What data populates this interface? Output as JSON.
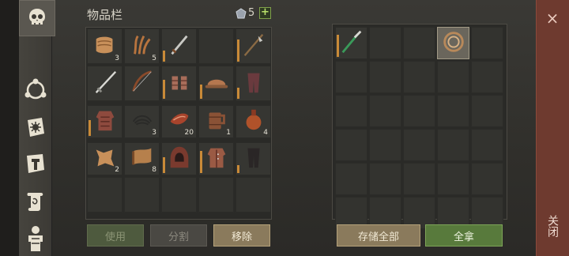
{
  "header": {
    "title": "物品栏",
    "gem_count": "5",
    "add_label": "+"
  },
  "inventory": {
    "rows": [
      [
        {
          "icon": "cloth-icon",
          "qty": "3"
        },
        {
          "icon": "fiber-icon",
          "qty": "5"
        },
        {
          "icon": "sword-icon",
          "qty": ""
        },
        {
          "icon": "",
          "qty": ""
        },
        {
          "icon": "halberd-icon",
          "qty": ""
        }
      ],
      [
        {
          "icon": "long-sword-icon",
          "qty": ""
        },
        {
          "icon": "bow-icon",
          "qty": ""
        },
        {
          "icon": "gloves-icon",
          "qty": ""
        },
        {
          "icon": "helmet-icon",
          "qty": ""
        },
        {
          "icon": "pants-icon",
          "qty": ""
        }
      ],
      [
        {
          "icon": "leather-armor-icon",
          "qty": ""
        },
        {
          "icon": "rope-icon",
          "qty": "3"
        },
        {
          "icon": "meat-icon",
          "qty": "20"
        },
        {
          "icon": "mug-icon",
          "qty": "1"
        },
        {
          "icon": "flask-icon",
          "qty": "4"
        }
      ],
      [
        {
          "icon": "hide-icon",
          "qty": "2"
        },
        {
          "icon": "scroll-leather-icon",
          "qty": "8"
        },
        {
          "icon": "hood-icon",
          "qty": ""
        },
        {
          "icon": "vest-icon",
          "qty": ""
        },
        {
          "icon": "dark-pants-icon",
          "qty": ""
        }
      ],
      [
        {
          "icon": "",
          "qty": ""
        },
        {
          "icon": "",
          "qty": ""
        },
        {
          "icon": "",
          "qty": ""
        },
        {
          "icon": "",
          "qty": ""
        },
        {
          "icon": "",
          "qty": ""
        }
      ]
    ]
  },
  "container": {
    "items": [
      {
        "icon": "dagger-icon"
      },
      {
        "icon": "coiled-rope-icon"
      }
    ]
  },
  "buttons": {
    "use": "使用",
    "split": "分割",
    "remove": "移除",
    "store_all": "存储全部",
    "take_all": "全拿"
  },
  "close": {
    "label": "关闭",
    "x": "×"
  },
  "colors": {
    "accent_bar": "#c98a38",
    "take_all": "#587a3c",
    "close_strip": "#6e3a2f"
  }
}
